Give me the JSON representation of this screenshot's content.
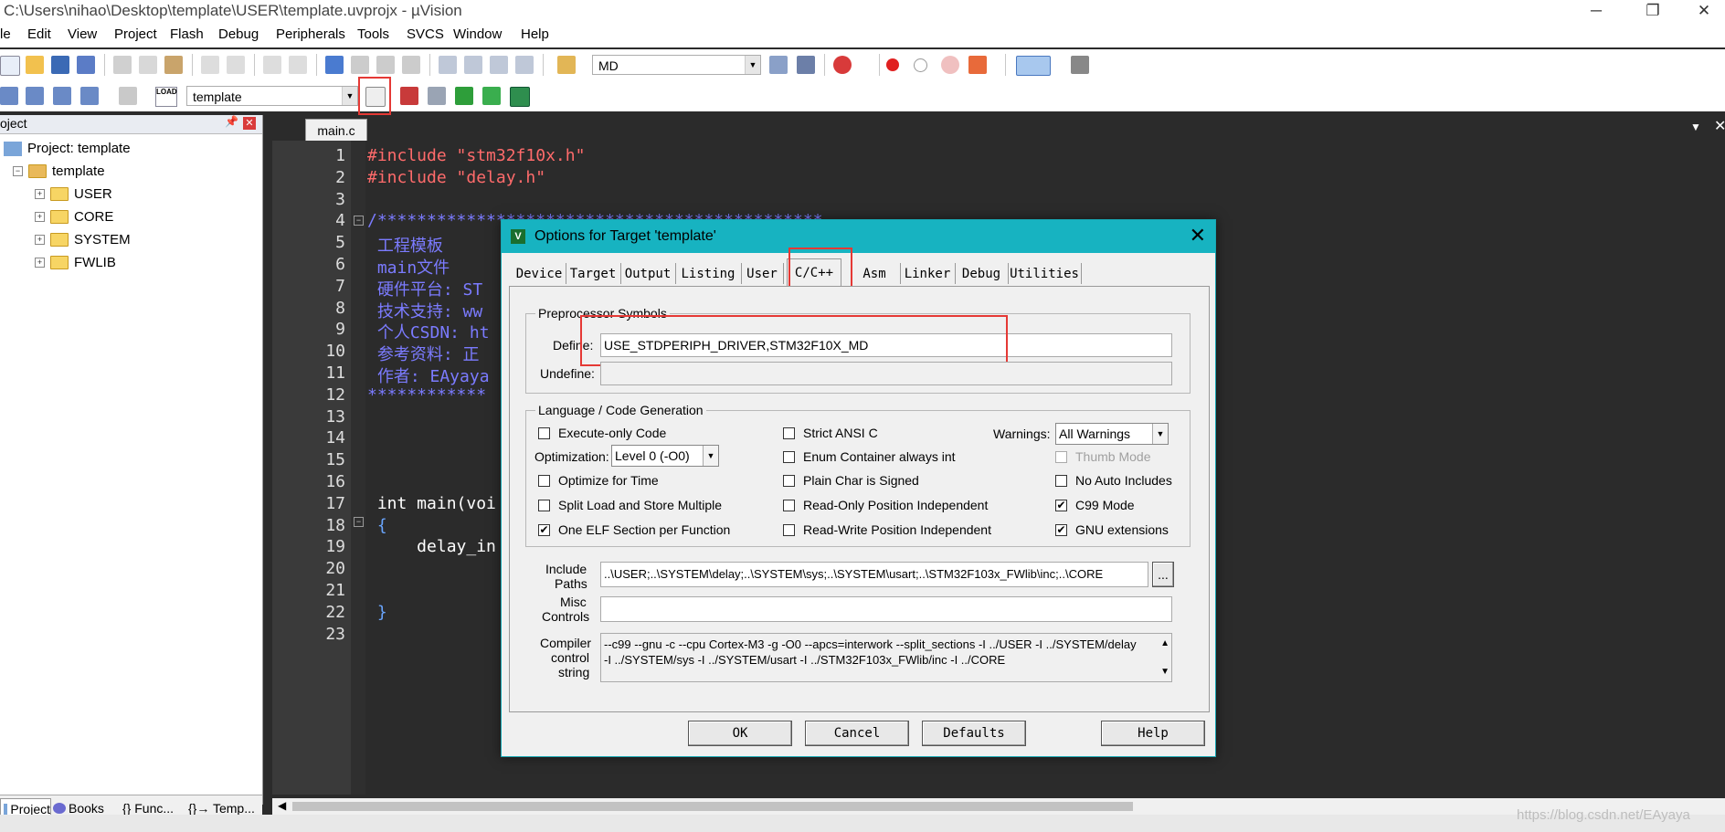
{
  "window": {
    "title": "C:\\Users\\nihao\\Desktop\\template\\USER\\template.uvprojx - µVision",
    "controls": [
      "─",
      "❐",
      "✕"
    ]
  },
  "menu": [
    "le",
    "Edit",
    "View",
    "Project",
    "Flash",
    "Debug",
    "Peripherals",
    "Tools",
    "SVCS",
    "Window",
    "Help"
  ],
  "toolbar1": {
    "target_combo": "MD"
  },
  "toolbar2": {
    "target_combo": "template",
    "load_label": "LOAD"
  },
  "project_panel": {
    "title": "oject",
    "root": "Project: template",
    "target": "template",
    "groups": [
      "USER",
      "CORE",
      "SYSTEM",
      "FWLIB"
    ],
    "tabs": [
      "Project",
      "Books",
      "{} Func...",
      "{}→ Temp..."
    ]
  },
  "editor": {
    "tab": "main.c",
    "line_numbers": [
      "1",
      "2",
      "3",
      "4",
      "5",
      "6",
      "7",
      "8",
      "9",
      "10",
      "11",
      "12",
      "13",
      "14",
      "15",
      "16",
      "17",
      "18",
      "19",
      "20",
      "21",
      "22",
      "23"
    ],
    "lines": [
      {
        "n": 1,
        "text": "#include \"stm32f10x.h\"",
        "color": "#ff6b6b"
      },
      {
        "n": 2,
        "text": "#include \"delay.h\"",
        "color": "#ff6b6b"
      },
      {
        "n": 4,
        "text": "/*********************************************",
        "color": "#7b7bff"
      },
      {
        "n": 5,
        "text": " 工程模板",
        "color": "#7b7bff"
      },
      {
        "n": 6,
        "text": " main文件",
        "color": "#7b7bff"
      },
      {
        "n": 7,
        "text": " 硬件平台: ST",
        "color": "#7b7bff"
      },
      {
        "n": 8,
        "text": " 技术支持: ww",
        "color": "#7b7bff"
      },
      {
        "n": 9,
        "text": " 个人CSDN: ht",
        "color": "#7b7bff"
      },
      {
        "n": 10,
        "text": " 参考资料: 正",
        "color": "#7b7bff"
      },
      {
        "n": 11,
        "text": " 作者: EAyaya",
        "color": "#7b7bff"
      },
      {
        "n": 12,
        "text": "************",
        "color": "#7b7bff"
      },
      {
        "n": 17,
        "text": " int main(voi",
        "color": "#ffffff"
      },
      {
        "n": 18,
        "text": " {",
        "color": "#6aa6ff"
      },
      {
        "n": 19,
        "text": "     delay_in",
        "color": "#ffffff"
      },
      {
        "n": 22,
        "text": " }",
        "color": "#6aa6ff"
      }
    ]
  },
  "dialog": {
    "title": "Options for Target 'template'",
    "tabs": [
      "Device",
      "Target",
      "Output",
      "Listing",
      "User",
      "C/C++",
      "Asm",
      "Linker",
      "Debug",
      "Utilities"
    ],
    "active_tab": "C/C++",
    "preprocessor": {
      "group_label": "Preprocessor Symbols",
      "define_label": "Define:",
      "define_value": "USE_STDPERIPH_DRIVER,STM32F10X_MD",
      "undefine_label": "Undefine:",
      "undefine_value": ""
    },
    "language": {
      "group_label": "Language / Code Generation",
      "execute_only": {
        "label": "Execute-only Code",
        "checked": false
      },
      "optimization_label": "Optimization:",
      "optimization_value": "Level 0 (-O0)",
      "optimize_time": {
        "label": "Optimize for Time",
        "checked": false
      },
      "split_load": {
        "label": "Split Load and Store Multiple",
        "checked": false
      },
      "one_elf": {
        "label": "One ELF Section per Function",
        "checked": true
      },
      "strict_ansi": {
        "label": "Strict ANSI C",
        "checked": false
      },
      "enum_container": {
        "label": "Enum Container always int",
        "checked": false
      },
      "plain_char": {
        "label": "Plain Char is Signed",
        "checked": false
      },
      "ro_pos": {
        "label": "Read-Only Position Independent",
        "checked": false
      },
      "rw_pos": {
        "label": "Read-Write Position Independent",
        "checked": false
      },
      "warnings_label": "Warnings:",
      "warnings_value": "All Warnings",
      "thumb_mode": {
        "label": "Thumb Mode",
        "checked": false
      },
      "no_auto": {
        "label": "No Auto Includes",
        "checked": false
      },
      "c99": {
        "label": "C99 Mode",
        "checked": true
      },
      "gnu_ext": {
        "label": "GNU extensions",
        "checked": true
      }
    },
    "include_label_1": "Include",
    "include_label_2": "Paths",
    "include_value": "..\\USER;..\\SYSTEM\\delay;..\\SYSTEM\\sys;..\\SYSTEM\\usart;..\\STM32F103x_FWlib\\inc;..\\CORE",
    "browse_label": "...",
    "misc_label_1": "Misc",
    "misc_label_2": "Controls",
    "misc_value": "",
    "compiler_label_1": "Compiler",
    "compiler_label_2": "control",
    "compiler_label_3": "string",
    "compiler_line_1": "--c99 --gnu -c --cpu Cortex-M3 -g -O0 --apcs=interwork --split_sections -I ../USER -I ../SYSTEM/delay",
    "compiler_line_2": "-I ../SYSTEM/sys -I ../SYSTEM/usart -I ../STM32F103x_FWlib/inc -I ../CORE",
    "buttons": {
      "ok": "OK",
      "cancel": "Cancel",
      "defaults": "Defaults",
      "help": "Help"
    }
  },
  "watermark": "https://blog.csdn.net/EAyaya"
}
